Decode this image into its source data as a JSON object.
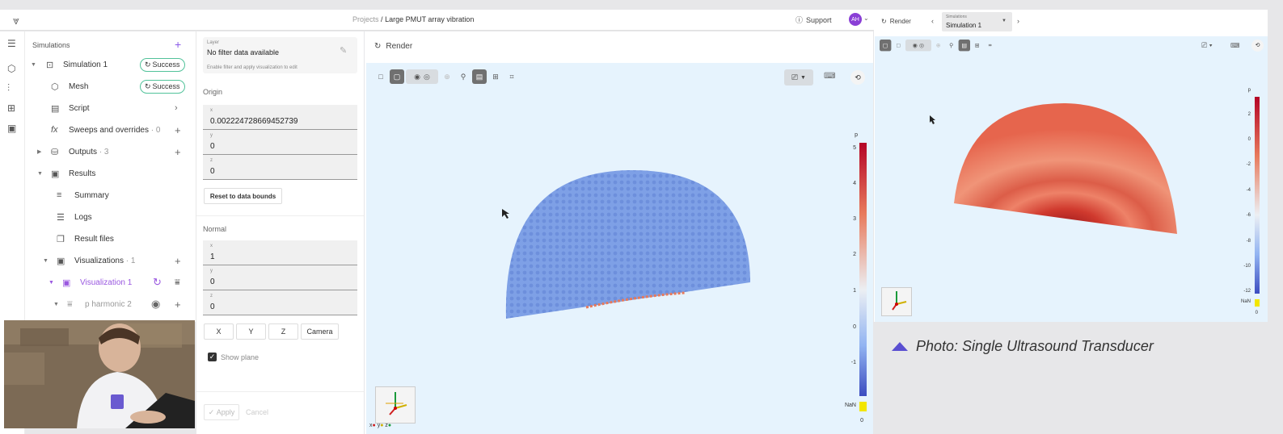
{
  "breadcrumb": {
    "projects": "Projects",
    "separator": "/",
    "current": "Large PMUT array vibration"
  },
  "header": {
    "support_label": "Support",
    "avatar_initials": "AH"
  },
  "tree": {
    "title": "Simulations",
    "items": [
      {
        "label": "Simulation 1",
        "badge": "Success",
        "icon": "simulation-icon"
      },
      {
        "label": "Mesh",
        "badge": "Success",
        "icon": "mesh-icon"
      },
      {
        "label": "Script",
        "icon": "script-icon"
      },
      {
        "label": "Sweeps and overrides",
        "count": "· 0",
        "icon": "function-icon"
      },
      {
        "label": "Outputs",
        "count": "· 3",
        "icon": "database-icon"
      },
      {
        "label": "Results",
        "icon": "results-icon"
      },
      {
        "label": "Summary",
        "icon": "summary-icon"
      },
      {
        "label": "Logs",
        "icon": "logs-icon"
      },
      {
        "label": "Result files",
        "icon": "files-icon"
      },
      {
        "label": "Visualizations",
        "count": "· 1",
        "icon": "visualizations-icon"
      },
      {
        "label": "Visualization 1",
        "icon": "visualization-icon",
        "selected": true
      },
      {
        "label": "p harmonic 2",
        "icon": "filter-icon"
      }
    ]
  },
  "filter_panel": {
    "layer_label": "Layer",
    "layer_value": "No filter data available",
    "layer_hint": "Enable filter and apply visualization to edit",
    "origin_title": "Origin",
    "origin": [
      {
        "label": "x",
        "value": "0.002224728669452739"
      },
      {
        "label": "y",
        "value": "0"
      },
      {
        "label": "z",
        "value": "0"
      }
    ],
    "reset_label": "Reset to data bounds",
    "normal_title": "Normal",
    "normal": [
      {
        "label": "x",
        "value": "1"
      },
      {
        "label": "y",
        "value": "0"
      },
      {
        "label": "z",
        "value": "0"
      }
    ],
    "axis_buttons": [
      "X",
      "Y",
      "Z",
      "Camera"
    ],
    "show_plane_label": "Show plane",
    "show_plane_checked": true,
    "apply_label": "Apply",
    "cancel_label": "Cancel"
  },
  "render": {
    "title": "Render",
    "colorbar": {
      "title": "p",
      "ticks": [
        "5",
        "4",
        "3",
        "2",
        "1",
        "0",
        "-1"
      ],
      "nan_label": "NaN",
      "bottom_label": "0"
    },
    "axes_labels": [
      "x",
      "y",
      "z"
    ]
  },
  "second_window": {
    "render_label": "Render",
    "tab_small": "Simulations",
    "tab_label": "Simulation 1",
    "colorbar": {
      "title": "p",
      "ticks": [
        "2",
        "0",
        "-2",
        "-4",
        "-6",
        "-8",
        "-10",
        "-12"
      ],
      "nan_label": "NaN",
      "bottom_label": "0"
    }
  },
  "caption": "Photo: Single Ultrasound Transducer",
  "colors": {
    "accent": "#8a5ae8",
    "success": "#52c29a",
    "canvas": "#e6f3fd",
    "caption_marker": "#5a4fd1"
  }
}
